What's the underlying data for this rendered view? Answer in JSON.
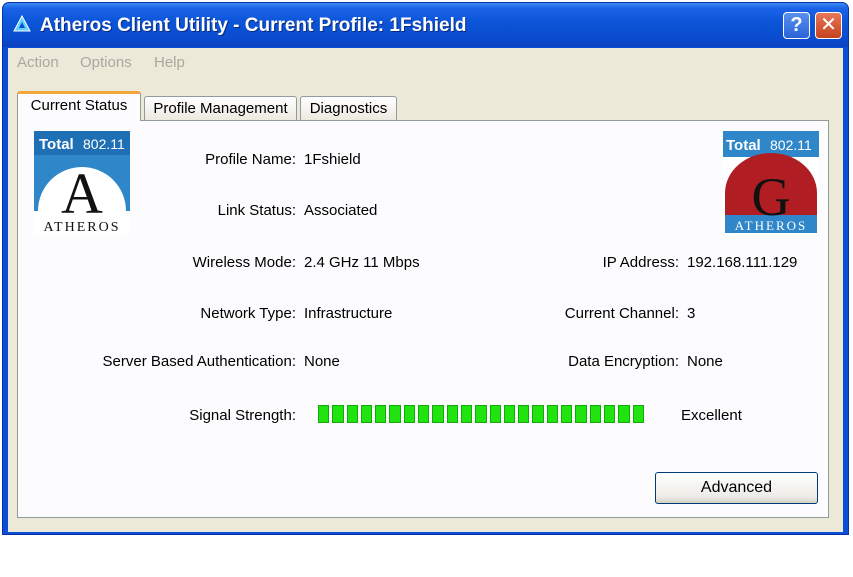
{
  "window": {
    "title": "Atheros Client Utility - Current Profile: 1Fshield",
    "help_glyph": "?",
    "close_glyph": "✕",
    "icon": "atheros-triangle-icon"
  },
  "menu": [
    "Action",
    "Options",
    "Help"
  ],
  "tabs": [
    {
      "label": "Current Status",
      "active": true
    },
    {
      "label": "Profile Management",
      "active": false
    },
    {
      "label": "Diagnostics",
      "active": false
    }
  ],
  "logos": {
    "left": {
      "line1": "Total",
      "line2": "802.11",
      "letter": "A",
      "brand": "ATHEROS"
    },
    "right": {
      "line1": "Total",
      "line2": "802.11",
      "letter": "G",
      "brand": "ATHEROS"
    }
  },
  "status": {
    "profile_name": {
      "label": "Profile Name:",
      "value": "1Fshield"
    },
    "link_status": {
      "label": "Link Status:",
      "value": "Associated"
    },
    "wireless_mode": {
      "label": "Wireless Mode:",
      "value": "2.4 GHz 11 Mbps"
    },
    "network_type": {
      "label": "Network Type:",
      "value": "Infrastructure"
    },
    "server_auth": {
      "label": "Server Based Authentication:",
      "value": "None"
    },
    "ip_address": {
      "label": "IP Address:",
      "value": "192.168.111.129"
    },
    "current_channel": {
      "label": "Current Channel:",
      "value": "3"
    },
    "data_encryption": {
      "label": "Data Encryption:",
      "value": "None"
    },
    "signal_strength": {
      "label": "Signal Strength:",
      "value": "Excellent",
      "level_percent": 100
    }
  },
  "buttons": {
    "advanced": "Advanced"
  },
  "colors": {
    "signal_green": "#21e30f",
    "title_blue": "#0a4fd6",
    "tab_highlight": "#f1a73a"
  }
}
